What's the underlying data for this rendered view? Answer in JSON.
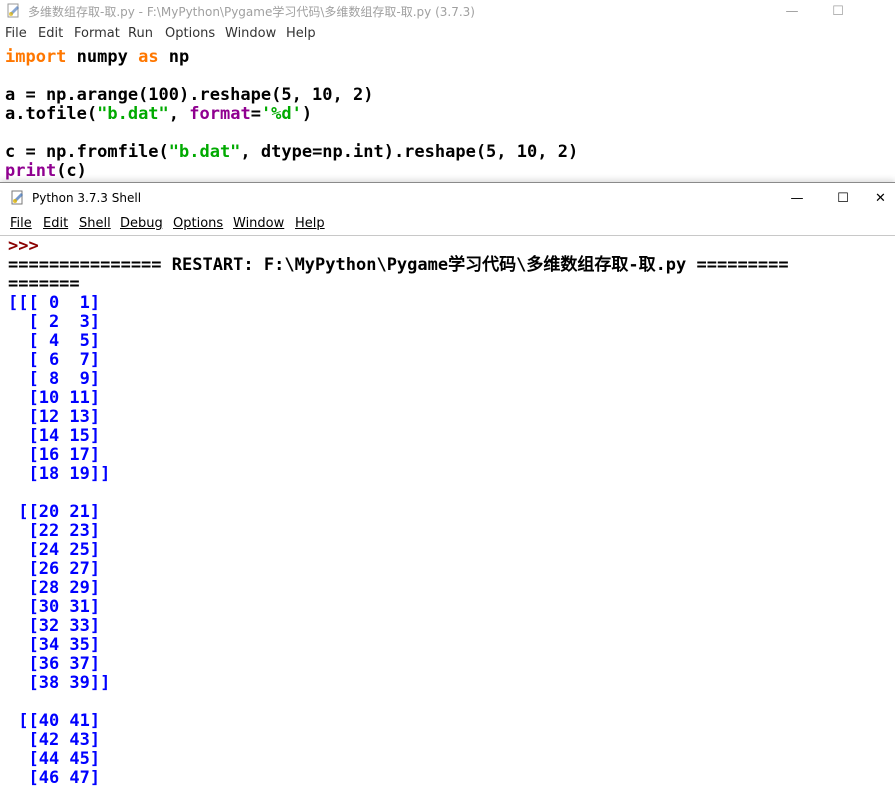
{
  "editor": {
    "title": "多维数组存取-取.py - F:\\MyPython\\Pygame学习代码\\多维数组存取-取.py (3.7.3)",
    "menu": [
      "File",
      "Edit",
      "Format",
      "Run",
      "Options",
      "Window",
      "Help"
    ],
    "code": {
      "l1": {
        "kw1": "import",
        "t1": " numpy ",
        "kw2": "as",
        "t2": " np"
      },
      "l2": "a = np.arange(100).reshape(5, 10, 2)",
      "l3": {
        "t1": "a.tofile(",
        "s1": "\"b.dat\"",
        "t2": ", ",
        "k1": "format",
        "t3": "=",
        "s2": "'%d'",
        "t4": ")"
      },
      "l4": {
        "t1": "c = np.fromfile(",
        "s1": "\"b.dat\"",
        "t2": ", dtype=np.int).reshape(5, 10, 2)"
      },
      "l5": {
        "b1": "print",
        "t1": "(c)"
      }
    }
  },
  "shell": {
    "title": "Python 3.7.3 Shell",
    "menu": [
      "File",
      "Edit",
      "Shell",
      "Debug",
      "Options",
      "Window",
      "Help"
    ],
    "prompt": ">>>",
    "restart_line1": "=============== RESTART: F:\\MyPython\\Pygame学习代码\\多维数组存取-取.py =========",
    "restart_line2": "=======",
    "output": [
      "[[[ 0  1]",
      "  [ 2  3]",
      "  [ 4  5]",
      "  [ 6  7]",
      "  [ 8  9]",
      "  [10 11]",
      "  [12 13]",
      "  [14 15]",
      "  [16 17]",
      "  [18 19]]",
      "",
      " [[20 21]",
      "  [22 23]",
      "  [24 25]",
      "  [26 27]",
      "  [28 29]",
      "  [30 31]",
      "  [32 33]",
      "  [34 35]",
      "  [36 37]",
      "  [38 39]]",
      "",
      " [[40 41]",
      "  [42 43]",
      "  [44 45]",
      "  [46 47]"
    ]
  },
  "window_controls": {
    "minimize": "—",
    "maximize": "☐",
    "close": "✕"
  },
  "colors": {
    "keyword": "#ff7700",
    "string": "#00aa00",
    "builtin": "#900090",
    "output": "#0000ff",
    "prompt": "#8b0000"
  }
}
